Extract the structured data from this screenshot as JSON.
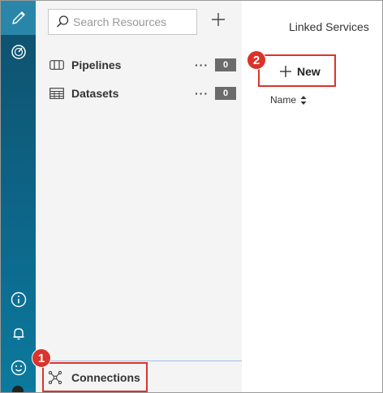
{
  "rail": {
    "items": [
      {
        "icon": "pencil-icon",
        "active": true
      },
      {
        "icon": "monitor-gauge-icon",
        "active": false
      }
    ],
    "bottom_items": [
      {
        "icon": "info-icon"
      },
      {
        "icon": "bell-icon"
      },
      {
        "icon": "smiley-icon"
      }
    ]
  },
  "resources": {
    "search_placeholder": "Search Resources",
    "add_icon": "plus-icon",
    "items": [
      {
        "label": "Pipelines",
        "icon": "pipeline-icon",
        "more": "···",
        "count": "0"
      },
      {
        "label": "Datasets",
        "icon": "table-icon",
        "more": "···",
        "count": "0"
      }
    ],
    "connections_label": "Connections"
  },
  "right_pane": {
    "tab_label": "Linked Services",
    "new_label": "New",
    "column_name": "Name"
  },
  "callouts": {
    "badge_1": "1",
    "badge_2": "2"
  },
  "colors": {
    "rail_top": "#0f4f6b",
    "rail_bottom": "#0b7a9e",
    "callout_red": "#d9342b",
    "panel_bg": "#f4f4f4",
    "count_badge": "#6b6b6b"
  }
}
